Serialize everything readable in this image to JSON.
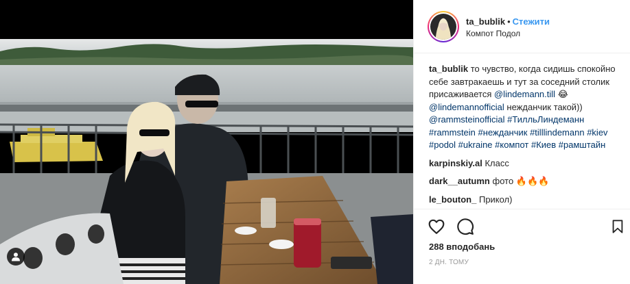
{
  "header": {
    "username": "ta_bublik",
    "separator": "•",
    "follow_label": "Стежити",
    "location": "Компот Подол"
  },
  "caption": {
    "username": "ta_bublik",
    "text_1": "то чувство, когда сидишь спокойно себе завтракаешь и тут за соседний столик присаживается",
    "mention_1": "@lindemann.till",
    "emoji_1": "😂",
    "mention_2": "@lindemannofficial",
    "text_2": "нежданчик такой))",
    "mention_3": "@rammsteinofficial",
    "hashtags": [
      "#ТилльЛиндеманн",
      "#rammstein",
      "#нежданчик",
      "#tilllindemann",
      "#kiev",
      "#podol",
      "#ukraine",
      "#компот",
      "#Киев",
      "#рамштайн"
    ]
  },
  "comments": [
    {
      "username": "karpinskiy.al",
      "text": "Класс"
    },
    {
      "username": "dark__autumn",
      "text": "фото 🔥🔥🔥"
    },
    {
      "username": "le_bouton_",
      "text": "Прикол)"
    }
  ],
  "actions": {
    "likes": "288 вподобань",
    "time": "2 дн. тому"
  },
  "icons": {
    "like": "heart-outline-icon",
    "comment": "speech-bubble-icon",
    "save": "bookmark-icon",
    "tag": "person-tag-icon"
  },
  "colors": {
    "link_blue": "#3897f0",
    "mention_navy": "#003569",
    "muted": "#999999",
    "border": "#efefef"
  }
}
